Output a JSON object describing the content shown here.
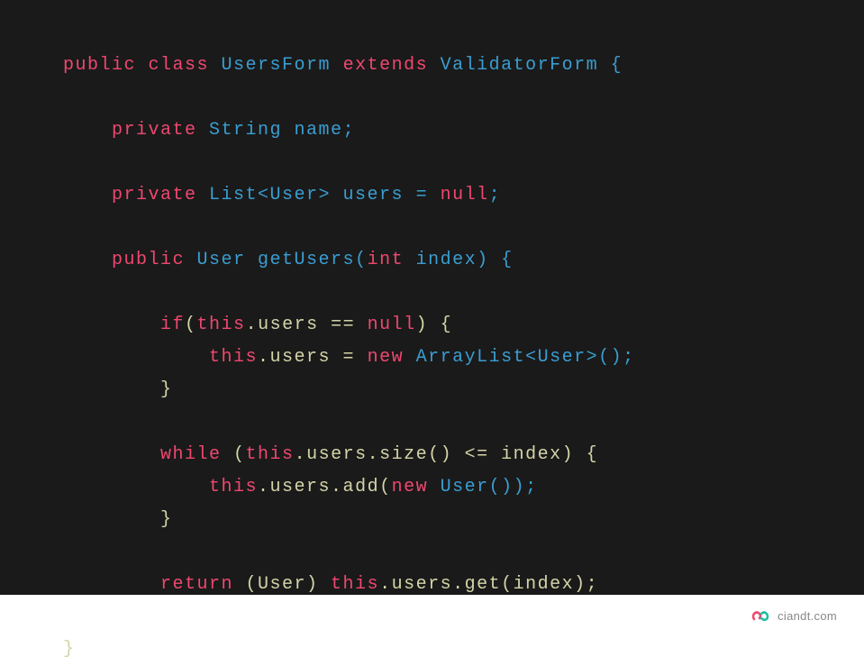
{
  "code": {
    "tokens": [
      [
        {
          "t": "public ",
          "c": "kw-public"
        },
        {
          "t": "class ",
          "c": "kw-class"
        },
        {
          "t": "UsersForm ",
          "c": "identifier"
        },
        {
          "t": "extends ",
          "c": "kw-extends"
        },
        {
          "t": "ValidatorForm {",
          "c": "identifier"
        }
      ],
      [],
      [
        {
          "t": "    ",
          "c": "plain"
        },
        {
          "t": "private ",
          "c": "kw-private"
        },
        {
          "t": "String name;",
          "c": "identifier"
        }
      ],
      [],
      [
        {
          "t": "    ",
          "c": "plain"
        },
        {
          "t": "private ",
          "c": "kw-private"
        },
        {
          "t": "List<User> users = ",
          "c": "identifier"
        },
        {
          "t": "null",
          "c": "kw-null"
        },
        {
          "t": ";",
          "c": "identifier"
        }
      ],
      [],
      [
        {
          "t": "    ",
          "c": "plain"
        },
        {
          "t": "public ",
          "c": "kw-public"
        },
        {
          "t": "User getUsers(",
          "c": "identifier"
        },
        {
          "t": "int ",
          "c": "kw-int"
        },
        {
          "t": "index) {",
          "c": "identifier"
        }
      ],
      [],
      [
        {
          "t": "        ",
          "c": "plain"
        },
        {
          "t": "if",
          "c": "kw-if"
        },
        {
          "t": "(",
          "c": "plain"
        },
        {
          "t": "this",
          "c": "kw-this"
        },
        {
          "t": ".users == ",
          "c": "plain"
        },
        {
          "t": "null",
          "c": "kw-null"
        },
        {
          "t": ") {",
          "c": "plain"
        }
      ],
      [
        {
          "t": "            ",
          "c": "plain"
        },
        {
          "t": "this",
          "c": "kw-this"
        },
        {
          "t": ".users = ",
          "c": "plain"
        },
        {
          "t": "new ",
          "c": "kw-new"
        },
        {
          "t": "ArrayList<User>();",
          "c": "identifier"
        }
      ],
      [
        {
          "t": "        }",
          "c": "plain"
        }
      ],
      [],
      [
        {
          "t": "        ",
          "c": "plain"
        },
        {
          "t": "while ",
          "c": "kw-while"
        },
        {
          "t": "(",
          "c": "plain"
        },
        {
          "t": "this",
          "c": "kw-this"
        },
        {
          "t": ".users.size() <= index) {",
          "c": "plain"
        }
      ],
      [
        {
          "t": "            ",
          "c": "plain"
        },
        {
          "t": "this",
          "c": "kw-this"
        },
        {
          "t": ".users.add(",
          "c": "plain"
        },
        {
          "t": "new ",
          "c": "kw-new"
        },
        {
          "t": "User());",
          "c": "identifier"
        }
      ],
      [
        {
          "t": "        }",
          "c": "plain"
        }
      ],
      [],
      [
        {
          "t": "        ",
          "c": "plain"
        },
        {
          "t": "return ",
          "c": "kw-return"
        },
        {
          "t": "(User) ",
          "c": "plain"
        },
        {
          "t": "this",
          "c": "kw-this"
        },
        {
          "t": ".users.get(index);",
          "c": "plain"
        }
      ],
      [
        {
          "t": "    }",
          "c": "plain"
        }
      ],
      [
        {
          "t": "}",
          "c": "plain"
        }
      ]
    ]
  },
  "footer": {
    "brand": "ciandt.com"
  }
}
